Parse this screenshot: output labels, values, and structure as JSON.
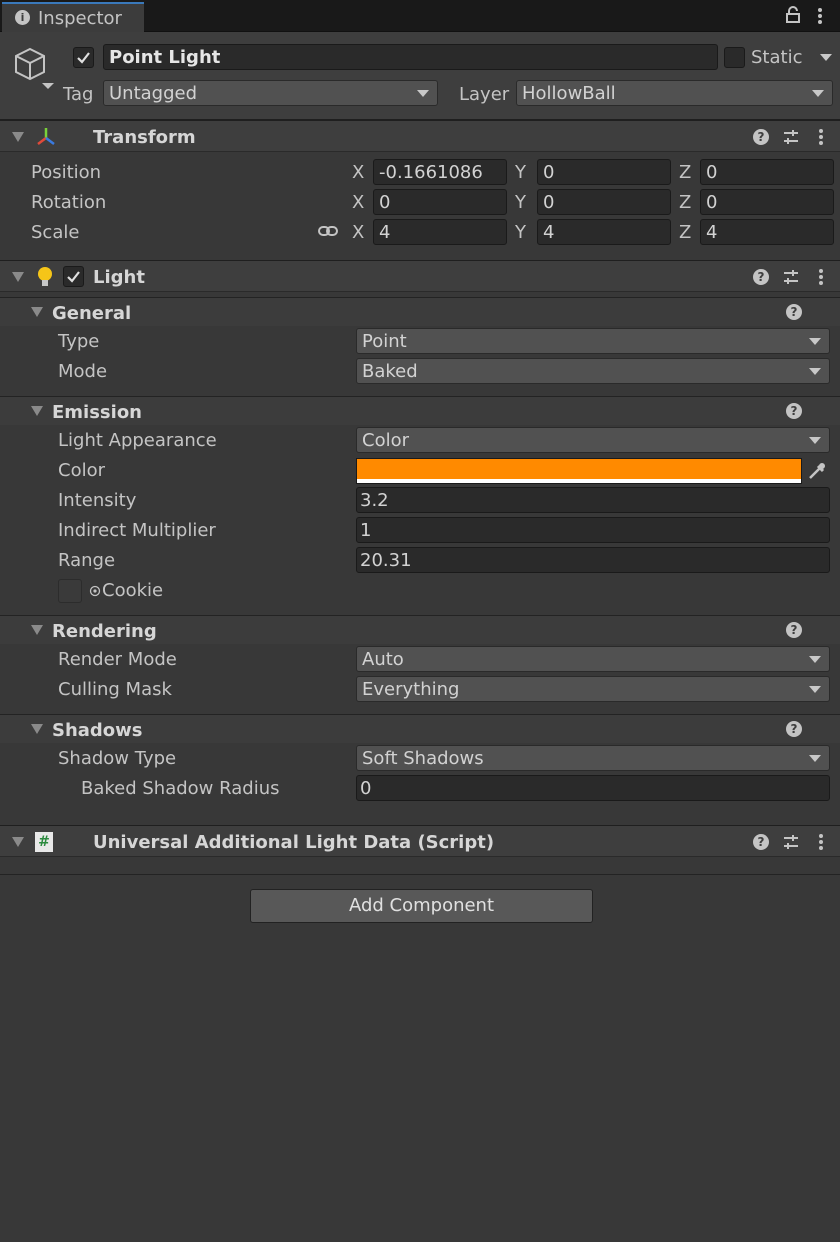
{
  "tab": {
    "title": "Inspector"
  },
  "header": {
    "object_name": "Point Light",
    "static_label": "Static",
    "tag_label": "Tag",
    "tag_value": "Untagged",
    "layer_label": "Layer",
    "layer_value": "HollowBall"
  },
  "transform": {
    "title": "Transform",
    "rows": [
      {
        "label": "Position",
        "x": "-0.1661086",
        "y": "0",
        "z": "0"
      },
      {
        "label": "Rotation",
        "x": "0",
        "y": "0",
        "z": "0"
      },
      {
        "label": "Scale",
        "x": "4",
        "y": "4",
        "z": "4"
      }
    ],
    "axis": {
      "x": "X",
      "y": "Y",
      "z": "Z"
    }
  },
  "light": {
    "title": "Light",
    "general": {
      "title": "General",
      "type_label": "Type",
      "type_value": "Point",
      "mode_label": "Mode",
      "mode_value": "Baked"
    },
    "emission": {
      "title": "Emission",
      "appearance_label": "Light Appearance",
      "appearance_value": "Color",
      "color_label": "Color",
      "color_value": "#ff8a00",
      "intensity_label": "Intensity",
      "intensity_value": "3.2",
      "indirect_label": "Indirect Multiplier",
      "indirect_value": "1",
      "range_label": "Range",
      "range_value": "20.31",
      "cookie_label": "Cookie"
    },
    "rendering": {
      "title": "Rendering",
      "render_mode_label": "Render Mode",
      "render_mode_value": "Auto",
      "culling_label": "Culling Mask",
      "culling_value": "Everything"
    },
    "shadows": {
      "title": "Shadows",
      "shadow_type_label": "Shadow Type",
      "shadow_type_value": "Soft Shadows",
      "baked_radius_label": "Baked Shadow Radius",
      "baked_radius_value": "0"
    }
  },
  "script_component": {
    "title": "Universal Additional Light Data (Script)"
  },
  "add_component": {
    "label": "Add Component"
  },
  "colors": {
    "accent": "#3a79bb",
    "light_color": "#ff8a00",
    "background": "#383838"
  }
}
